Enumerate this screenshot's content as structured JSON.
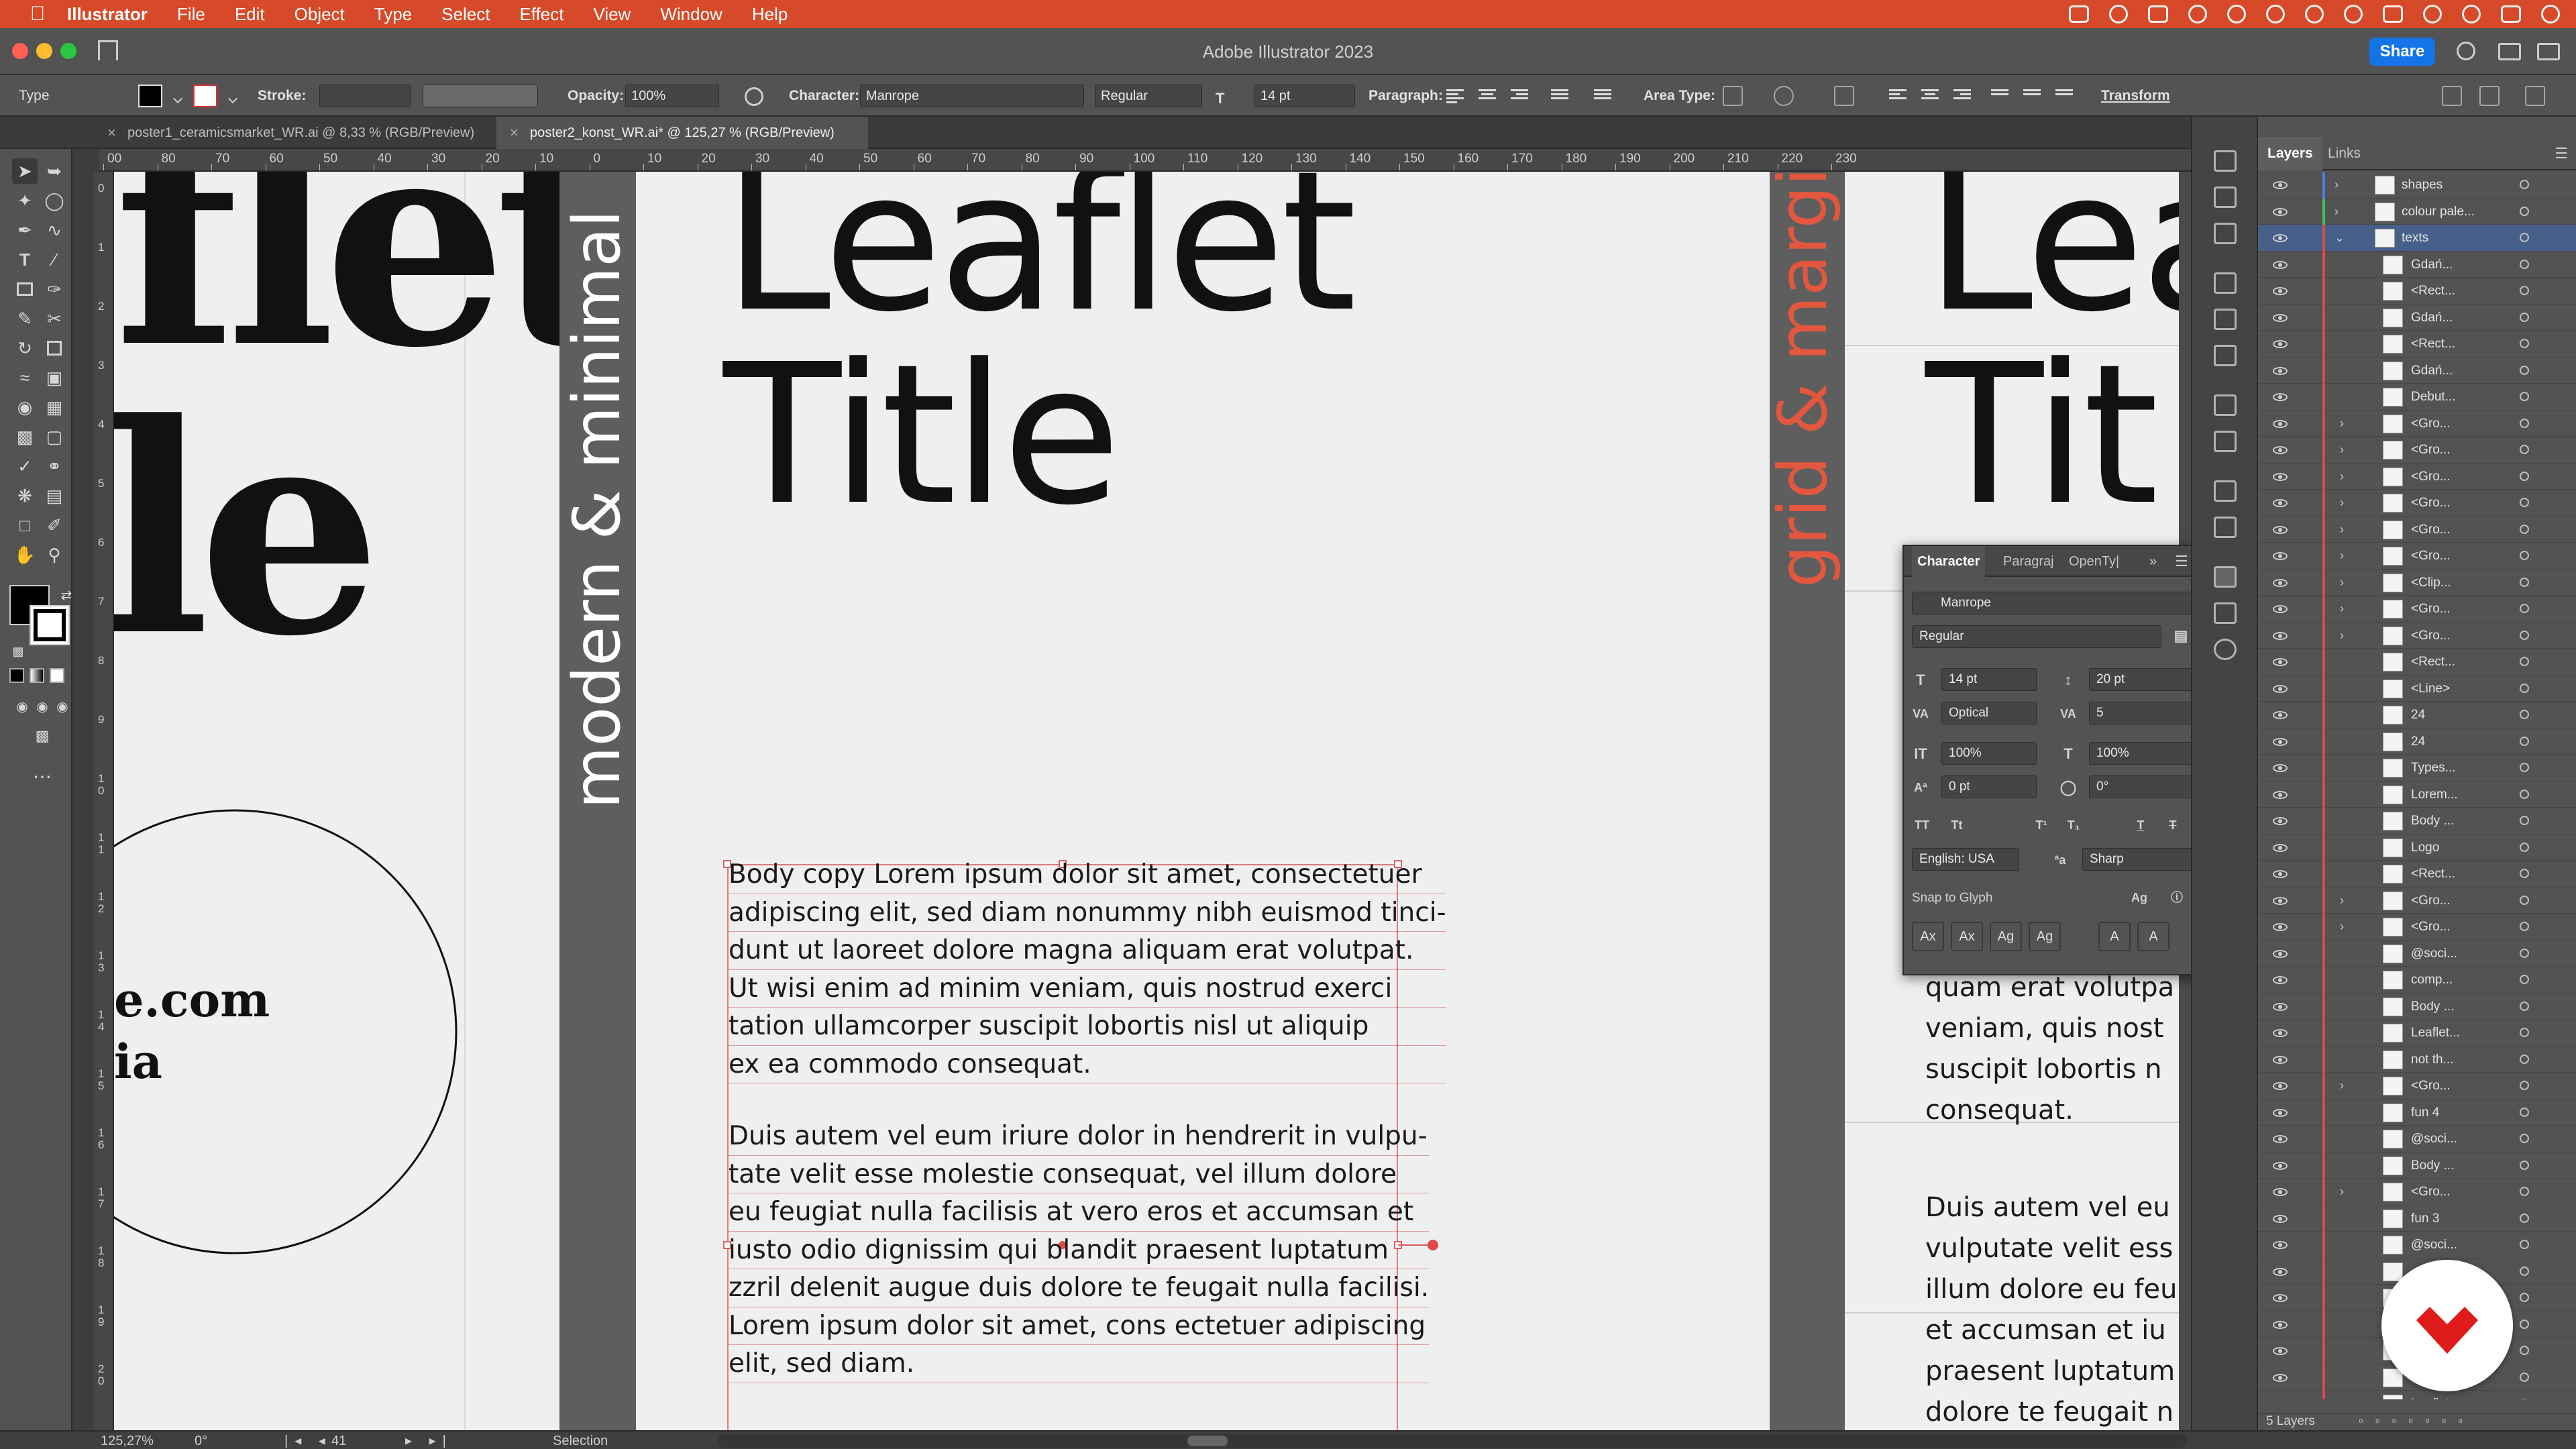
{
  "menubar": {
    "app": "Illustrator",
    "items": [
      "File",
      "Edit",
      "Object",
      "Type",
      "Select",
      "Effect",
      "View",
      "Window",
      "Help"
    ]
  },
  "titlebar": {
    "title": "Adobe Illustrator 2023",
    "share_label": "Share"
  },
  "controlbar": {
    "selection_type": "Type",
    "stroke_label": "Stroke:",
    "opacity_label": "Opacity:",
    "opacity_value": "100%",
    "character_label": "Character:",
    "font": "Manrope",
    "style": "Regular",
    "size": "14 pt",
    "paragraph_label": "Paragraph:",
    "area_type_label": "Area Type:",
    "transform_label": "Transform"
  },
  "tabs": [
    {
      "label": "poster1_ceramicsmarket_WR.ai @ 8,33 % (RGB/Preview)"
    },
    {
      "label": "poster2_konst_WR.ai* @ 125,27 % (RGB/Preview)"
    }
  ],
  "rulers": {
    "horizontal": [
      "00",
      "80",
      "70",
      "60",
      "50",
      "40",
      "30",
      "20",
      "10",
      "0",
      "10",
      "20",
      "30",
      "40",
      "50",
      "60",
      "70",
      "80",
      "90",
      "100",
      "110",
      "120",
      "130",
      "140",
      "150",
      "160",
      "170",
      "180",
      "190",
      "200",
      "210",
      "220",
      "230"
    ],
    "vertical": [
      "0",
      "1",
      "2",
      "3",
      "4",
      "5",
      "6",
      "7",
      "8",
      "9",
      "1\n0",
      "1\n1",
      "1\n2",
      "1\n3",
      "1\n4",
      "1\n5",
      "1\n6",
      "1\n7",
      "1\n8",
      "1\n9",
      "2\n0"
    ]
  },
  "artwork": {
    "left_big_1": "flet",
    "left_big_2": "le",
    "left_web": "e.com",
    "left_web2": "ia",
    "vertical_dark": "modern & minimal",
    "title_line1": "Leaflet",
    "title_line2": "Title",
    "vertical_red": "grid & margi",
    "right_title1": "Lea",
    "right_title2": "Tit",
    "body_para1": [
      "Body copy Lorem ipsum dolor sit amet, consectetuer",
      "adipiscing elit, sed diam nonummy nibh euismod tinci-",
      "dunt ut laoreet dolore magna aliquam erat volutpat.",
      "Ut wisi enim ad minim veniam, quis nostrud exerci",
      "tation ullamcorper suscipit lobortis nisl ut aliquip",
      "ex ea commodo consequat."
    ],
    "body_para2": [
      "Duis autem vel eum iriure dolor in hendrerit in vulpu-",
      "tate velit esse molestie consequat, vel illum dolore",
      "eu feugiat nulla facilisis at vero eros et accumsan et",
      "iusto odio dignissim qui blandit praesent luptatum",
      "zzril delenit augue duis dolore te feugait nulla facilisi.",
      "Lorem ipsum dolor sit amet, cons ectetuer adipiscing",
      "elit, sed diam."
    ],
    "right_para1": [
      "quam erat volutpa",
      "veniam, quis nost",
      "suscipit lobortis n",
      "consequat."
    ],
    "right_para2": [
      "Duis autem vel eu",
      "vulputate velit ess",
      "illum dolore eu feu",
      "et accumsan et iu",
      "praesent luptatum",
      "dolore te feugait n"
    ]
  },
  "character_panel": {
    "tabs": [
      "Character",
      "Paragraj",
      "OpenTy|"
    ],
    "font": "Manrope",
    "style": "Regular",
    "size": "14 pt",
    "leading": "20 pt",
    "kerning": "Optical",
    "tracking": "5",
    "vscale": "100%",
    "hscale": "100%",
    "baseline": "0 pt",
    "rotation": "0°",
    "language": "English: USA",
    "antialias": "Sharp",
    "snap_label": "Snap to Glyph"
  },
  "layers_panel": {
    "tabs": [
      "Layers",
      "Links"
    ],
    "rows": [
      {
        "name": "shapes",
        "level": 0,
        "arrow": "right"
      },
      {
        "name": "colour pale...",
        "level": 0,
        "arrow": "right"
      },
      {
        "name": "texts",
        "level": 0,
        "arrow": "down"
      },
      {
        "name": "Gdań...",
        "level": 1,
        "arrow": ""
      },
      {
        "name": "<Rect...",
        "level": 1,
        "arrow": ""
      },
      {
        "name": "Gdań...",
        "level": 1,
        "arrow": ""
      },
      {
        "name": "<Rect...",
        "level": 1,
        "arrow": ""
      },
      {
        "name": "Gdań...",
        "level": 1,
        "arrow": ""
      },
      {
        "name": "Debut...",
        "level": 1,
        "arrow": ""
      },
      {
        "name": "<Gro...",
        "level": 1,
        "arrow": "right"
      },
      {
        "name": "<Gro...",
        "level": 1,
        "arrow": "right"
      },
      {
        "name": "<Gro...",
        "level": 1,
        "arrow": "right"
      },
      {
        "name": "<Gro...",
        "level": 1,
        "arrow": "right"
      },
      {
        "name": "<Gro...",
        "level": 1,
        "arrow": "right"
      },
      {
        "name": "<Gro...",
        "level": 1,
        "arrow": "right"
      },
      {
        "name": "<Clip...",
        "level": 1,
        "arrow": "right"
      },
      {
        "name": "<Gro...",
        "level": 1,
        "arrow": "right"
      },
      {
        "name": "<Gro...",
        "level": 1,
        "arrow": "right"
      },
      {
        "name": "<Rect...",
        "level": 1,
        "arrow": ""
      },
      {
        "name": "<Line>",
        "level": 1,
        "arrow": ""
      },
      {
        "name": "24",
        "level": 1,
        "arrow": ""
      },
      {
        "name": "24",
        "level": 1,
        "arrow": ""
      },
      {
        "name": "Types...",
        "level": 1,
        "arrow": ""
      },
      {
        "name": "Lorem...",
        "level": 1,
        "arrow": ""
      },
      {
        "name": "Body ...",
        "level": 1,
        "arrow": ""
      },
      {
        "name": "Logo",
        "level": 1,
        "arrow": ""
      },
      {
        "name": "<Rect...",
        "level": 1,
        "arrow": ""
      },
      {
        "name": "<Gro...",
        "level": 1,
        "arrow": "right"
      },
      {
        "name": "<Gro...",
        "level": 1,
        "arrow": "right"
      },
      {
        "name": "@soci...",
        "level": 1,
        "arrow": ""
      },
      {
        "name": "comp...",
        "level": 1,
        "arrow": ""
      },
      {
        "name": "Body ...",
        "level": 1,
        "arrow": ""
      },
      {
        "name": "Leaflet...",
        "level": 1,
        "arrow": ""
      },
      {
        "name": "not th...",
        "level": 1,
        "arrow": ""
      },
      {
        "name": "<Gro...",
        "level": 1,
        "arrow": "right"
      },
      {
        "name": "fun 4",
        "level": 1,
        "arrow": ""
      },
      {
        "name": "@soci...",
        "level": 1,
        "arrow": ""
      },
      {
        "name": "Body ...",
        "level": 1,
        "arrow": ""
      },
      {
        "name": "<Gro...",
        "level": 1,
        "arrow": "right"
      },
      {
        "name": "fun 3",
        "level": 1,
        "arrow": ""
      },
      {
        "name": "@soci...",
        "level": 1,
        "arrow": ""
      },
      {
        "name": "",
        "level": 1,
        "arrow": ""
      },
      {
        "name": "",
        "level": 1,
        "arrow": ""
      },
      {
        "name": "",
        "level": 1,
        "arrow": ""
      },
      {
        "name": "",
        "level": 1,
        "arrow": ""
      },
      {
        "name": "",
        "level": 1,
        "arrow": ""
      },
      {
        "name": "Leaflet...",
        "level": 1,
        "arrow": ""
      }
    ],
    "footer": "5 Layers"
  },
  "statusbar": {
    "zoom": "125,27%",
    "rotation": "0°",
    "artboard": "41",
    "tool": "Selection"
  },
  "colors": {
    "menubar": "#d64a2a",
    "accent_red": "#e2573d",
    "share_blue": "#1473e6"
  }
}
